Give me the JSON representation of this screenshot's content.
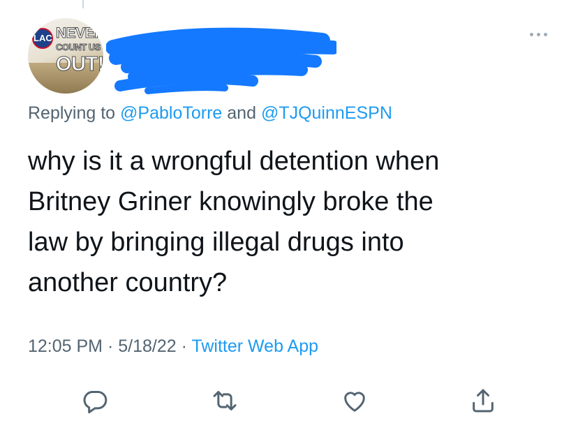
{
  "author": {
    "avatar": {
      "logo_text": "LAC",
      "caption_line1": "NEVER",
      "caption_line2": "COUNT US",
      "caption_line3": "OUT!"
    },
    "name_redacted": true
  },
  "reply_context": {
    "prefix": "Replying to",
    "mention1": "@PabloTorre",
    "conjunction": "and",
    "mention2": "@TJQuinnESPN"
  },
  "tweet": {
    "lines": [
      "why is it a wrongful detention when",
      "Britney Griner knowingly broke the",
      "law by bringing illegal drugs into",
      "another country?"
    ]
  },
  "meta": {
    "time": "12:05 PM",
    "separator": "·",
    "date": "5/18/22",
    "source": "Twitter Web App"
  },
  "actions": [
    {
      "icon": "reply-icon"
    },
    {
      "icon": "retweet-icon"
    },
    {
      "icon": "like-icon"
    },
    {
      "icon": "share-icon"
    }
  ],
  "colors": {
    "text": "#0f1419",
    "secondary": "#536471",
    "accent": "#1d9bf0",
    "redaction": "#1479ff"
  }
}
